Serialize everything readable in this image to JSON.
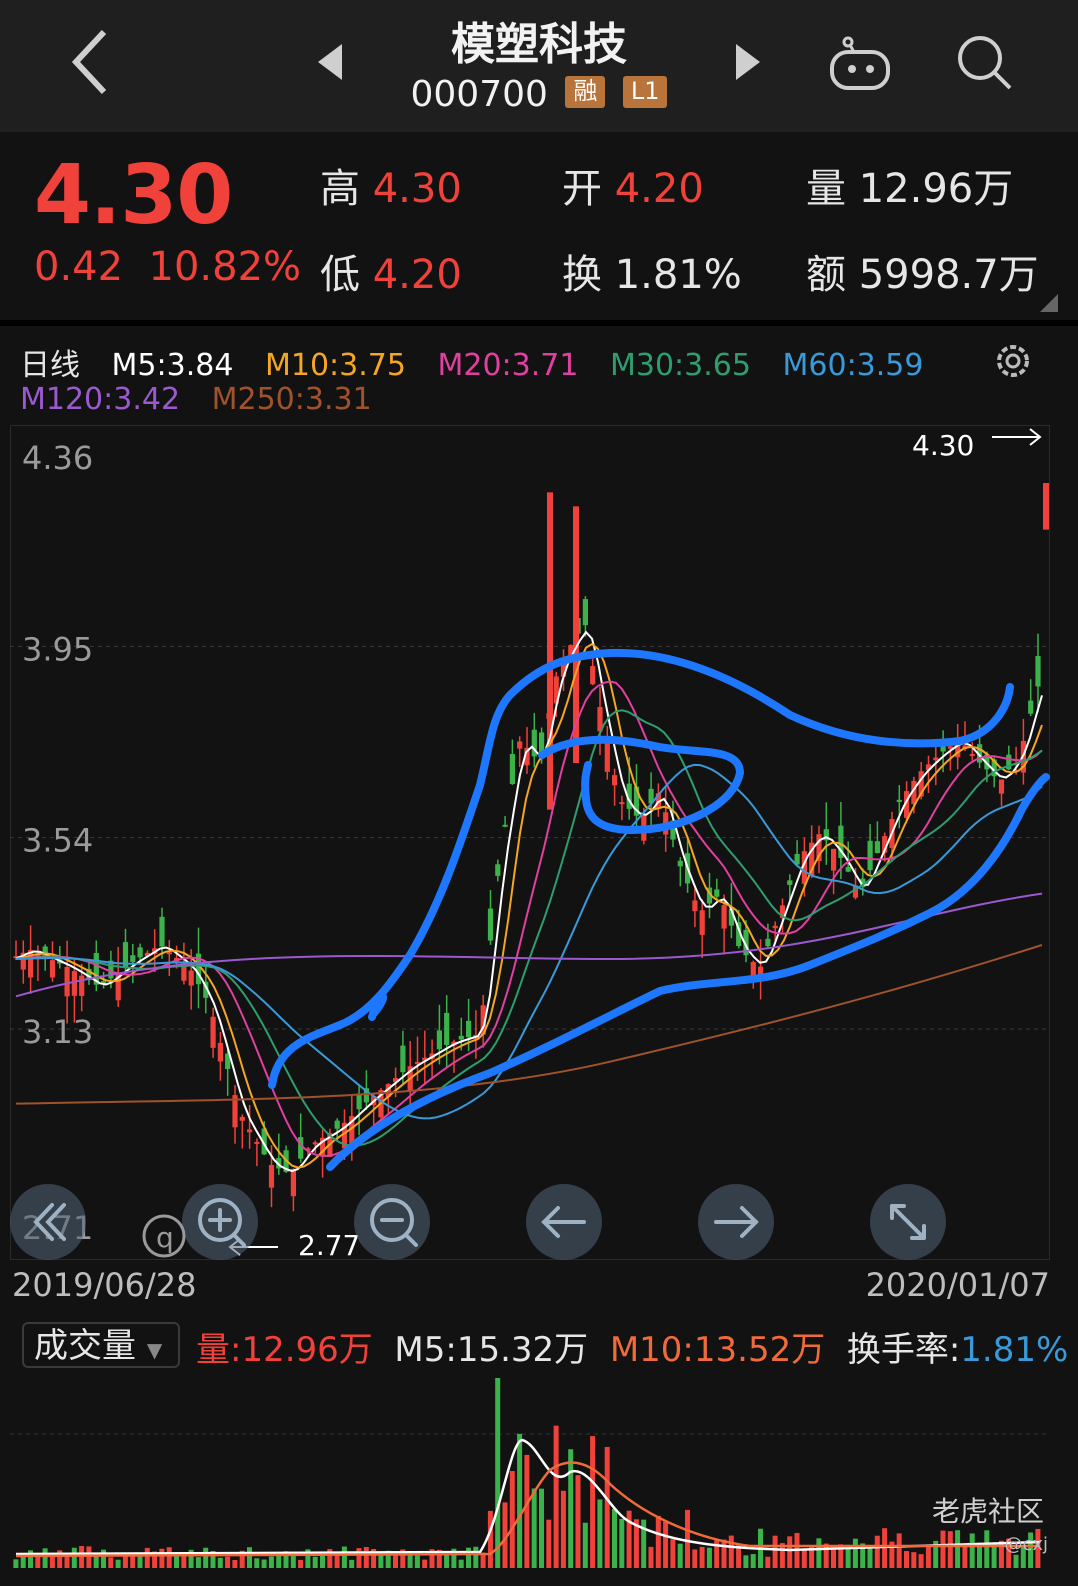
{
  "header": {
    "title": "模塑科技",
    "code": "000700",
    "badges": [
      "融",
      "L1"
    ]
  },
  "quote": {
    "price": "4.30",
    "change": "0.42",
    "change_pct": "10.82%",
    "high_label": "高",
    "high": "4.30",
    "open_label": "开",
    "open": "4.20",
    "volume_label": "量",
    "volume": "12.96万",
    "low_label": "低",
    "low": "4.20",
    "turnover_label": "换",
    "turnover": "1.81%",
    "amount_label": "额",
    "amount": "5998.7万"
  },
  "ma": {
    "period": "日线",
    "m5": "M5:3.84",
    "m10": "M10:3.75",
    "m20": "M20:3.71",
    "m30": "M30:3.65",
    "m60": "M60:3.59",
    "m120": "M120:3.42",
    "m250": "M250:3.31"
  },
  "colors": {
    "up": "#f0413a",
    "down": "#3cb34a",
    "m5": "#ffffff",
    "m10": "#f5a623",
    "m20": "#e040a0",
    "m30": "#2e9e6e",
    "m60": "#3a9ad9",
    "m120": "#9b59d0",
    "m250": "#a0522d",
    "annotation": "#1e78ff"
  },
  "chart": {
    "y_labels": [
      "4.36",
      "3.95",
      "3.54",
      "3.13",
      "2.71"
    ],
    "high_marker": "4.30",
    "low_marker": "2.77",
    "date_start": "2019/06/28",
    "date_end": "2020/01/07"
  },
  "controls": [
    "double-left",
    "zoom-in",
    "zoom-out",
    "left",
    "right",
    "expand"
  ],
  "volume": {
    "selector": "成交量",
    "vol": "量:12.96万",
    "m5": "M5:15.32万",
    "m10": "M10:13.52万",
    "turnover_label": "换手率:",
    "turnover": "1.81%"
  },
  "watermark": {
    "brand": "老虎社区",
    "user": "@cxj"
  }
}
